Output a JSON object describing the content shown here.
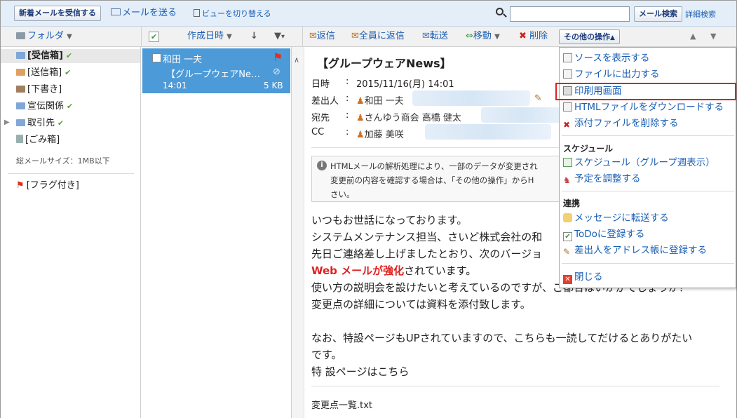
{
  "toolbar": {
    "receive_btn": "新着メールを受信する",
    "send_mail": "メールを送る",
    "switch_view": "ビューを切り替える",
    "search_btn": "メール検索",
    "advanced_search": "詳細検索",
    "search_value": ""
  },
  "subbar": {
    "folder": "フォルダ",
    "sort": "作成日時",
    "reply": "返信",
    "reply_all": "全員に返信",
    "forward": "転送",
    "move": "移動",
    "delete": "削除",
    "other_actions": "その他の操作"
  },
  "folders": {
    "items": [
      "[受信箱]",
      "[送信箱]",
      "[下書き]",
      "宣伝関係",
      "取引先",
      "[ごみ箱]"
    ],
    "total_size": "総メールサイズ：1MB以下",
    "flagged": "[フラグ付き]"
  },
  "mail": {
    "sender": "和田 一夫",
    "subject": "【グループウェアNe…",
    "time": "14:01",
    "size": "5 KB"
  },
  "message": {
    "subject": "【グループウェアNews】",
    "date_label": "日時",
    "date": "2015/11/16(月) 14:01",
    "from_label": "差出人",
    "from": "和田 一夫",
    "to_label": "宛先",
    "to": "さんゆう商会 高橋 健太",
    "cc_label": "CC",
    "cc": "加藤 美咲",
    "notice_lines": [
      "HTMLメールの解析処理により、一部のデータが変更され",
      "変更前の内容を確認する場合は、「その他の操作」からH",
      "さい。"
    ],
    "body": [
      "いつもお世話になっております。",
      "システムメンテナンス担当、さいど株式会社の和",
      "先日ご連絡差し上げましたとおり、次のバージョ",
      "使い方の説明会を設けたいと考えているのですが、ご都合はいかがでしょうか？",
      "変更点の詳細については資料を添付致します。",
      "なお、特設ページもUPされていますので、こちらも一読してだけるとありがたい",
      "です。"
    ],
    "body_red": "Web メールが強化",
    "body_red_rest": "されています。",
    "special_link": "特 設ページはこちら",
    "attachment": "変更点一覧.txt"
  },
  "menu": {
    "items": [
      "ソースを表示する",
      "ファイルに出力する",
      "印刷用画面",
      "HTMLファイルをダウンロードする",
      "添付ファイルを削除する"
    ],
    "schedule_head": "スケジュール",
    "schedule_items": [
      "スケジュール（グループ週表示）",
      "予定を調整する"
    ],
    "link_head": "連携",
    "link_items": [
      "メッセージに転送する",
      "ToDoに登録する",
      "差出人をアドレス帳に登録する"
    ],
    "close": "閉じる"
  }
}
